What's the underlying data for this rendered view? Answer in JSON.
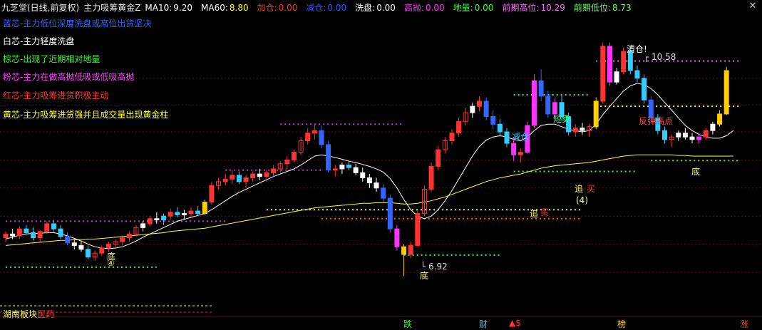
{
  "header": {
    "app_title": "九芝堂(日线,前复权)",
    "indicator_name": "主力吸筹黄金Z",
    "fields": [
      {
        "label": "MA10:",
        "value": "9.20",
        "color": "#ffffff"
      },
      {
        "label": "MA60:",
        "value": "8.80",
        "color": "#ffff00"
      },
      {
        "label": "加仓:",
        "value": "0.00",
        "color": "#ff3333"
      },
      {
        "label": "减仓:",
        "value": "0.00",
        "color": "#3355ff"
      },
      {
        "label": "洗盘:",
        "value": "0.00",
        "color": "#ffffff"
      },
      {
        "label": "高抛:",
        "value": "0.00",
        "color": "#ff33ff"
      },
      {
        "label": "地量:",
        "value": "0.00",
        "color": "#33ff33"
      },
      {
        "label": "前期高位:",
        "value": "10.29",
        "color": "#ff66ff"
      },
      {
        "label": "前期低位:",
        "value": "8.73",
        "color": "#66ff66"
      }
    ],
    "close_icon": "close-icon"
  },
  "legend": [
    {
      "text": "蓝芯-主力低位深度洗盘或高位出货坚决",
      "color": "#3366ff"
    },
    {
      "text": "白芯-主力轻度洗盘",
      "color": "#ffffff"
    },
    {
      "text": "棕芯-出现了近期相对地量",
      "color": "#33ff33"
    },
    {
      "text": "粉芯-主力在做高抛低吸或低吸高抛",
      "color": "#ff44ff"
    },
    {
      "text": "红芯-主力吸筹进货积极主动",
      "color": "#ff3333"
    },
    {
      "text": "黄芯-主力吸筹进货强并且成交量出现黄金柱",
      "color": "#ffff33"
    }
  ],
  "annotations": {
    "high_price": "10.58",
    "low_price": "6.92",
    "qingcang": "清仓!",
    "jiancang": "减仓",
    "duanmai": "短卖",
    "fantan": "反弹高点",
    "di_1": "底",
    "di_2": "底",
    "di_3": "底",
    "zhui_1": "追",
    "zhui_2": "追",
    "mai_1": "买",
    "mai_2": "买",
    "circle_1": "④",
    "circle_2": "(4)"
  },
  "bottom": {
    "sector_a": "湖南板块",
    "sector_b": "医药",
    "tags": [
      {
        "text": "跌",
        "color": "#33ff33"
      },
      {
        "text": "财",
        "color": "#33ccff"
      },
      {
        "text": "▲$",
        "color": "#ff3333"
      },
      {
        "text": "榜",
        "color": "#ffcc33"
      },
      {
        "text": "涨",
        "color": "#ff3333"
      }
    ]
  },
  "chart_data": {
    "type": "candlestick",
    "ylim": [
      6.5,
      11.0
    ],
    "levels": {
      "prior_high": 10.29,
      "prior_low": 8.73,
      "ma10_last": 9.2,
      "ma60_last": 8.8
    },
    "candles": [
      [
        7.52,
        7.62,
        7.45,
        7.58,
        "r"
      ],
      [
        7.58,
        7.66,
        7.5,
        7.55,
        "w"
      ],
      [
        7.55,
        7.7,
        7.5,
        7.66,
        "r"
      ],
      [
        7.66,
        7.72,
        7.58,
        7.6,
        "c"
      ],
      [
        7.6,
        7.68,
        7.48,
        7.52,
        "c"
      ],
      [
        7.52,
        7.64,
        7.46,
        7.62,
        "r"
      ],
      [
        7.62,
        7.78,
        7.58,
        7.74,
        "r"
      ],
      [
        7.74,
        7.8,
        7.62,
        7.66,
        "c"
      ],
      [
        7.66,
        7.72,
        7.5,
        7.54,
        "c"
      ],
      [
        7.54,
        7.6,
        7.4,
        7.44,
        "b"
      ],
      [
        7.44,
        7.5,
        7.34,
        7.4,
        "w"
      ],
      [
        7.4,
        7.46,
        7.3,
        7.34,
        "w"
      ],
      [
        7.34,
        7.4,
        7.18,
        7.22,
        "c"
      ],
      [
        7.22,
        7.32,
        7.16,
        7.28,
        "r"
      ],
      [
        7.28,
        7.4,
        7.24,
        7.36,
        "r"
      ],
      [
        7.36,
        7.46,
        7.3,
        7.42,
        "r"
      ],
      [
        7.42,
        7.5,
        7.36,
        7.46,
        "r"
      ],
      [
        7.46,
        7.56,
        7.4,
        7.52,
        "r"
      ],
      [
        7.52,
        7.62,
        7.46,
        7.58,
        "r"
      ],
      [
        7.58,
        7.72,
        7.54,
        7.68,
        "r"
      ],
      [
        7.68,
        7.78,
        7.62,
        7.74,
        "w"
      ],
      [
        7.74,
        7.86,
        7.7,
        7.82,
        "r"
      ],
      [
        7.82,
        7.92,
        7.74,
        7.8,
        "w"
      ],
      [
        7.8,
        7.9,
        7.72,
        7.86,
        "c"
      ],
      [
        7.86,
        7.98,
        7.8,
        7.92,
        "r"
      ],
      [
        7.92,
        8.0,
        7.84,
        7.88,
        "c"
      ],
      [
        7.88,
        7.96,
        7.8,
        7.9,
        "w"
      ],
      [
        7.9,
        8.0,
        7.84,
        7.94,
        "r"
      ],
      [
        7.94,
        8.02,
        7.86,
        7.9,
        "c"
      ],
      [
        7.9,
        8.12,
        7.88,
        8.08,
        "y"
      ],
      [
        8.08,
        8.4,
        8.04,
        8.34,
        "r"
      ],
      [
        8.34,
        8.46,
        8.28,
        8.4,
        "r"
      ],
      [
        8.4,
        8.52,
        8.34,
        8.44,
        "r"
      ],
      [
        8.44,
        8.58,
        8.36,
        8.5,
        "r"
      ],
      [
        8.5,
        8.56,
        8.36,
        8.4,
        "c"
      ],
      [
        8.4,
        8.5,
        8.3,
        8.46,
        "r"
      ],
      [
        8.46,
        8.56,
        8.4,
        8.52,
        "r"
      ],
      [
        8.52,
        8.6,
        8.42,
        8.48,
        "w"
      ],
      [
        8.48,
        8.58,
        8.4,
        8.54,
        "r"
      ],
      [
        8.54,
        8.66,
        8.48,
        8.6,
        "r"
      ],
      [
        8.6,
        8.72,
        8.54,
        8.68,
        "r"
      ],
      [
        8.68,
        8.8,
        8.6,
        8.74,
        "r"
      ],
      [
        8.74,
        8.9,
        8.7,
        8.86,
        "r"
      ],
      [
        8.86,
        9.1,
        8.82,
        9.04,
        "r"
      ],
      [
        9.04,
        9.24,
        8.98,
        9.16,
        "r"
      ],
      [
        9.16,
        9.3,
        9.06,
        9.2,
        "r"
      ],
      [
        9.2,
        9.28,
        8.92,
        8.98,
        "b"
      ],
      [
        8.98,
        9.04,
        8.54,
        8.58,
        "b"
      ],
      [
        8.58,
        8.66,
        8.48,
        8.6,
        "r"
      ],
      [
        8.6,
        8.7,
        8.52,
        8.66,
        "w"
      ],
      [
        8.66,
        8.74,
        8.58,
        8.62,
        "c"
      ],
      [
        8.62,
        8.68,
        8.5,
        8.54,
        "w"
      ],
      [
        8.54,
        8.62,
        8.4,
        8.46,
        "w"
      ],
      [
        8.46,
        8.52,
        8.3,
        8.38,
        "w"
      ],
      [
        8.38,
        8.46,
        8.24,
        8.3,
        "w"
      ],
      [
        8.3,
        8.36,
        8.08,
        8.14,
        "b"
      ],
      [
        8.14,
        8.2,
        7.6,
        7.66,
        "b"
      ],
      [
        7.66,
        7.72,
        7.32,
        7.38,
        "p"
      ],
      [
        7.38,
        7.42,
        6.92,
        7.26,
        "y"
      ],
      [
        7.26,
        7.46,
        7.2,
        7.4,
        "r"
      ],
      [
        7.4,
        7.96,
        7.38,
        7.9,
        "r"
      ],
      [
        7.9,
        8.34,
        7.86,
        8.28,
        "r"
      ],
      [
        8.28,
        8.7,
        8.24,
        8.64,
        "r"
      ],
      [
        8.64,
        8.96,
        8.58,
        8.9,
        "r"
      ],
      [
        8.9,
        9.1,
        8.84,
        9.04,
        "r"
      ],
      [
        9.04,
        9.22,
        8.98,
        9.16,
        "r"
      ],
      [
        9.16,
        9.4,
        9.1,
        9.34,
        "r"
      ],
      [
        9.34,
        9.56,
        9.28,
        9.48,
        "r"
      ],
      [
        9.48,
        9.64,
        9.4,
        9.58,
        "w"
      ],
      [
        9.58,
        9.74,
        9.5,
        9.66,
        "r"
      ],
      [
        9.66,
        9.72,
        9.36,
        9.42,
        "b"
      ],
      [
        9.42,
        9.52,
        9.22,
        9.3,
        "b"
      ],
      [
        9.3,
        9.38,
        9.1,
        9.18,
        "c"
      ],
      [
        9.18,
        9.24,
        8.94,
        9.0,
        "c"
      ],
      [
        9.0,
        9.1,
        8.72,
        8.82,
        "p"
      ],
      [
        8.82,
        8.92,
        8.7,
        8.86,
        "r"
      ],
      [
        8.86,
        9.34,
        8.84,
        9.28,
        "p"
      ],
      [
        9.28,
        10.08,
        9.24,
        9.98,
        "p"
      ],
      [
        9.98,
        10.16,
        9.66,
        9.74,
        "b"
      ],
      [
        9.74,
        9.82,
        9.4,
        9.46,
        "b"
      ],
      [
        9.46,
        9.7,
        9.4,
        9.64,
        "p"
      ],
      [
        9.64,
        9.76,
        9.36,
        9.42,
        "c"
      ],
      [
        9.42,
        9.48,
        9.12,
        9.18,
        "c"
      ],
      [
        9.18,
        9.3,
        9.1,
        9.24,
        "r"
      ],
      [
        9.24,
        9.32,
        9.14,
        9.2,
        "w"
      ],
      [
        9.2,
        9.3,
        9.1,
        9.26,
        "r"
      ],
      [
        9.26,
        9.72,
        9.22,
        9.66,
        "y"
      ],
      [
        9.66,
        10.58,
        9.62,
        10.52,
        "r"
      ],
      [
        10.52,
        10.58,
        9.9,
        9.96,
        "p"
      ],
      [
        9.96,
        10.18,
        9.92,
        10.12,
        "w"
      ],
      [
        10.12,
        10.5,
        10.08,
        10.44,
        "r"
      ],
      [
        10.44,
        10.52,
        10.08,
        10.14,
        "c"
      ],
      [
        10.14,
        10.22,
        9.96,
        10.02,
        "c"
      ],
      [
        10.02,
        10.08,
        9.62,
        9.68,
        "c"
      ],
      [
        9.68,
        9.74,
        9.34,
        9.4,
        "b"
      ],
      [
        9.4,
        9.46,
        9.14,
        9.2,
        "c"
      ],
      [
        9.2,
        9.26,
        9.0,
        9.06,
        "c"
      ],
      [
        9.06,
        9.14,
        8.94,
        9.1,
        "r"
      ],
      [
        9.1,
        9.2,
        9.04,
        9.16,
        "w"
      ],
      [
        9.16,
        9.24,
        9.06,
        9.1,
        "w"
      ],
      [
        9.1,
        9.16,
        9.0,
        9.06,
        "w"
      ],
      [
        9.06,
        9.14,
        9.0,
        9.1,
        "p"
      ],
      [
        9.1,
        9.24,
        9.06,
        9.2,
        "r"
      ],
      [
        9.2,
        9.34,
        9.14,
        9.3,
        "w"
      ],
      [
        9.3,
        9.52,
        9.26,
        9.46,
        "y"
      ],
      [
        9.46,
        10.2,
        9.44,
        10.14,
        "y"
      ]
    ],
    "ma10": [
      7.5,
      7.53,
      7.56,
      7.58,
      7.59,
      7.59,
      7.6,
      7.6,
      7.58,
      7.55,
      7.51,
      7.47,
      7.42,
      7.38,
      7.36,
      7.35,
      7.36,
      7.38,
      7.42,
      7.47,
      7.53,
      7.58,
      7.63,
      7.68,
      7.73,
      7.78,
      7.81,
      7.84,
      7.87,
      7.9,
      7.96,
      8.03,
      8.1,
      8.17,
      8.23,
      8.28,
      8.33,
      8.38,
      8.43,
      8.48,
      8.52,
      8.56,
      8.6,
      8.66,
      8.73,
      8.8,
      8.82,
      8.8,
      8.78,
      8.75,
      8.72,
      8.7,
      8.67,
      8.64,
      8.6,
      8.55,
      8.45,
      8.3,
      8.12,
      7.96,
      7.86,
      7.82,
      7.86,
      7.96,
      8.1,
      8.26,
      8.44,
      8.62,
      8.8,
      8.95,
      9.05,
      9.1,
      9.12,
      9.1,
      9.06,
      9.04,
      9.1,
      9.2,
      9.28,
      9.3,
      9.3,
      9.26,
      9.22,
      9.2,
      9.18,
      9.2,
      9.3,
      9.45,
      9.58,
      9.7,
      9.82,
      9.9,
      9.94,
      9.92,
      9.86,
      9.76,
      9.64,
      9.52,
      9.4,
      9.28,
      9.2,
      9.14,
      9.1,
      9.08,
      9.08,
      9.12,
      9.2
    ],
    "ma60": [
      7.4,
      7.41,
      7.42,
      7.43,
      7.44,
      7.45,
      7.46,
      7.47,
      7.48,
      7.48,
      7.49,
      7.49,
      7.5,
      7.5,
      7.51,
      7.52,
      7.53,
      7.54,
      7.55,
      7.56,
      7.57,
      7.58,
      7.59,
      7.6,
      7.62,
      7.63,
      7.64,
      7.65,
      7.66,
      7.67,
      7.69,
      7.71,
      7.73,
      7.75,
      7.77,
      7.79,
      7.81,
      7.83,
      7.85,
      7.87,
      7.89,
      7.91,
      7.93,
      7.95,
      7.97,
      7.99,
      8.0,
      8.01,
      8.02,
      8.03,
      8.04,
      8.05,
      8.06,
      8.06,
      8.07,
      8.07,
      8.07,
      8.06,
      8.05,
      8.05,
      8.06,
      8.08,
      8.1,
      8.13,
      8.16,
      8.2,
      8.24,
      8.28,
      8.32,
      8.36,
      8.4,
      8.43,
      8.46,
      8.48,
      8.5,
      8.52,
      8.55,
      8.58,
      8.61,
      8.63,
      8.65,
      8.66,
      8.67,
      8.68,
      8.69,
      8.7,
      8.72,
      8.74,
      8.76,
      8.78,
      8.8,
      8.81,
      8.82,
      8.82,
      8.82,
      8.82,
      8.82,
      8.82,
      8.81,
      8.81,
      8.8,
      8.8,
      8.8,
      8.8,
      8.8,
      8.8,
      8.8
    ],
    "dotted_levels": [
      {
        "price": 7.78,
        "from": 0,
        "to": 32,
        "color": "#cc33cc"
      },
      {
        "price": 7.06,
        "from": 0,
        "to": 22,
        "color": "#33ff33"
      },
      {
        "price": 8.58,
        "from": 32,
        "to": 46,
        "color": "#cc33cc"
      },
      {
        "price": 9.3,
        "from": 40,
        "to": 58,
        "color": "#cc33cc"
      },
      {
        "price": 7.96,
        "from": 38,
        "to": 84,
        "color": "#eeee66"
      },
      {
        "price": 7.82,
        "from": 46,
        "to": 84,
        "color": "#ff4444"
      },
      {
        "price": 7.25,
        "from": 58,
        "to": 72,
        "color": "#33ff33"
      },
      {
        "price": 8.56,
        "from": 74,
        "to": 92,
        "color": "#33ff33"
      },
      {
        "price": 9.76,
        "from": 74,
        "to": 85,
        "color": "#33ff33"
      },
      {
        "price": 10.29,
        "from": 86,
        "to": 107,
        "color": "#ff66ff"
      },
      {
        "price": 9.58,
        "from": 86,
        "to": 107,
        "color": "#ffff33"
      },
      {
        "price": 8.73,
        "from": 94,
        "to": 107,
        "color": "#33ff33"
      }
    ],
    "guides": [
      {
        "price": 10.02,
        "color": "#661111"
      },
      {
        "price": 9.6,
        "color": "#661111"
      },
      {
        "price": 9.18,
        "color": "#661111"
      },
      {
        "price": 8.74,
        "color": "#661111"
      },
      {
        "price": 8.3,
        "color": "#661111"
      },
      {
        "price": 7.86,
        "color": "#661111"
      },
      {
        "price": 7.42,
        "color": "#661111"
      },
      {
        "price": 6.98,
        "color": "#661111"
      }
    ]
  }
}
